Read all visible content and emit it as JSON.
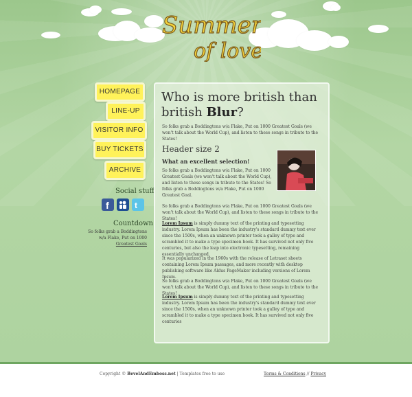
{
  "logo": {
    "line1": "Summer",
    "line2": "of love"
  },
  "nav": {
    "items": [
      {
        "label": "HOMEPAGE"
      },
      {
        "label": "LINE-UP"
      },
      {
        "label": "VISITOR INFO"
      },
      {
        "label": "BUY TICKETS"
      },
      {
        "label": "ARCHIVE"
      }
    ]
  },
  "social": {
    "title": "Social stuff",
    "icons": [
      "facebook-icon",
      "myspace-icon",
      "twitter-icon"
    ]
  },
  "countdown": {
    "title": "Countdown",
    "text": "So folks grab a Boddingtons w/a Flake, Put on 1000",
    "link": "Greatest Goals"
  },
  "main": {
    "title_plain": "Who is more british than british ",
    "title_bold": "Blur",
    "title_end": "?",
    "intro": "So folks grab a Boddingtons w/a Flake, Put on 1000 Greatest Goals (we won't talk about the World Cup), and listen to these songs in tribute to the States!",
    "header2": "Header size 2",
    "header3": "What an excellent selection!",
    "para1": "So folks grab a Boddingtons w/a Flake, Put on 1000 Greatest Goals (we won't talk about the World Cup), and listen to these songs in tribute to the States! So folks grab a Boddingtons w/a Flake, Put on 1000 Greatest Goal.",
    "para2": "So folks grab a Boddingtons w/a Flake, Put on 1000 Greatest Goals (we won't talk about the World Cup), and listen to these songs in tribute to the States!",
    "lorem_link": "Lorem Ipsum",
    "lorem1": " is simply dummy text of the printing and typesetting industry. Lorem Ipsum has been the industry's standard dummy text ever since the 1500s, when an unknown printer took a galley of type and scrambled it to make a type specimen book. It has survived not only five centuries, but also the leap into electronic typesetting, remaining essentially unchanged.",
    "para3": "It was popularized in the 1960s with the release of Letraset sheets containing Lorem Ipsum passages, and more recently with desktop publishing software like Aldus PageMaker including versions of Lorem Ipsum.",
    "para4": "So folks grab a Boddingtons w/a Flake, Put on 1000 Greatest Goals (we won't talk about the World Cup), and listen to these songs in tribute to the States!",
    "lorem2": " is simply dummy text of the printing and typesetting industry. Lorem Ipsum has been the industry's standard dummy text ever since the 1500s, when an unknown printer took a galley of type and scrambled it to make a type specimen book. It has survived not only five centuries"
  },
  "footer": {
    "copyright_prefix": "Copyright © ",
    "copyright_site": "BevelAndEmboss.net",
    "copyright_suffix": " | Templates free to use",
    "terms": "Terms & Conditions",
    "separator": " // ",
    "privacy": "Privacy"
  },
  "colors": {
    "accent": "#fff25a",
    "background": "#a9cf9a",
    "footer_line": "#6ea660"
  }
}
